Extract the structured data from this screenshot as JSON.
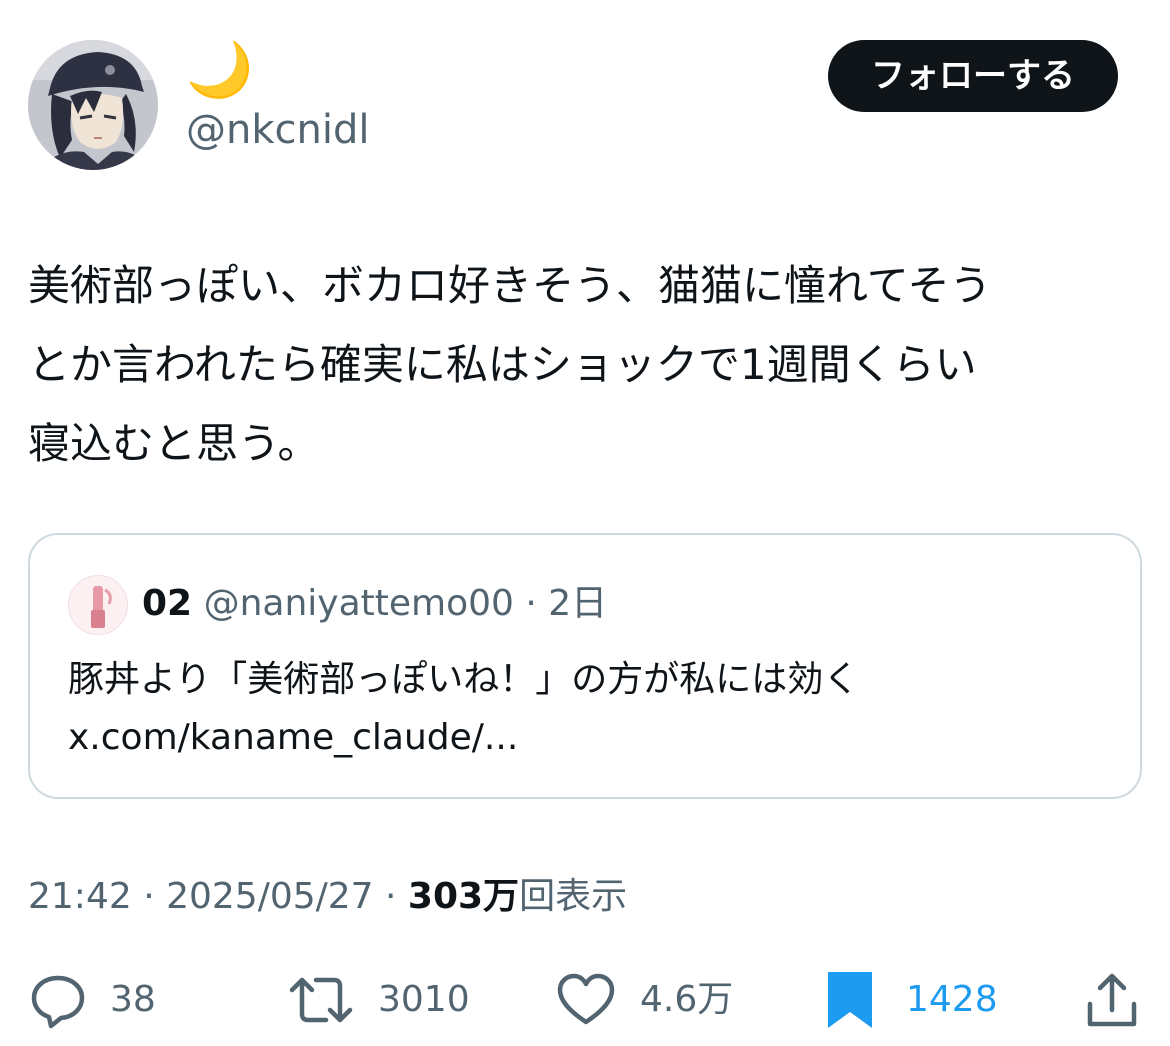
{
  "author": {
    "display_name": "🌙",
    "handle": "@nkcnidl"
  },
  "follow_button": {
    "label": "フォローする"
  },
  "tweet": {
    "text": "美術部っぽい、ボカロ好きそう、猫猫に憧れてそう\nとか言われたら確実に私はショックで1週間くらい\n寝込むと思う。"
  },
  "quoted": {
    "name": "02",
    "handle_time": "@naniyattemo00 · 2日",
    "text": "豚丼より「美術部っぽいね！」の方が私には効く",
    "link": "x.com/kaname_claude/..."
  },
  "meta": {
    "time_date": "21:42 · 2025/05/27 · ",
    "views_count": "303万",
    "views_label": "回表示"
  },
  "actions": {
    "reply_count": "38",
    "retweet_count": "3010",
    "like_count": "4.6万",
    "bookmark_count": "1428"
  },
  "colors": {
    "text": "#0f1419",
    "secondary": "#536471",
    "accent": "#1d9bf0",
    "border": "#cfd9de"
  },
  "icons": [
    "avatar-image",
    "moon-emoji",
    "reply-icon",
    "retweet-icon",
    "heart-icon",
    "bookmark-icon",
    "share-icon"
  ]
}
